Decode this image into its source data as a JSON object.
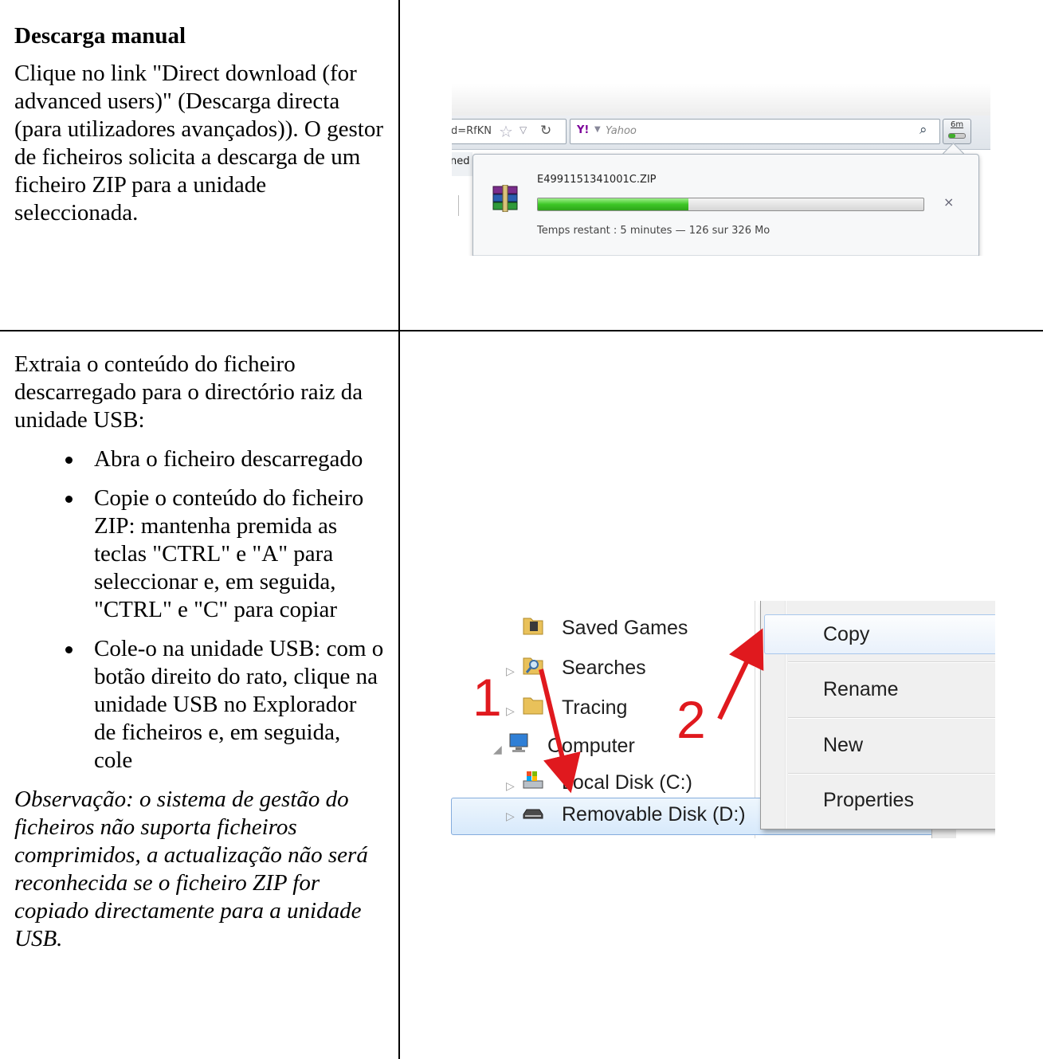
{
  "section1": {
    "title": "Descarga manual",
    "body": "Clique no link \"Direct download (for advanced users)\" (Descarga directa (para utilizadores avançados)). O gestor de ficheiros solicita a descarga de um ficheiro ZIP para a unidade seleccionada."
  },
  "section2": {
    "intro": "Extraia o conteúdo do ficheiro descarregado para o directório raiz da unidade USB:",
    "bullets": [
      "Abra o ficheiro descarregado",
      "Copie o conteúdo do ficheiro ZIP: mantenha premida as teclas \"CTRL\" e \"A\" para seleccionar e, em seguida, \"CTRL\" e \"C\" para copiar",
      "Cole-o na unidade USB: com o botão direito do rato, clique na unidade USB no Explorador de ficheiros e, em seguida, cole"
    ],
    "note": "Observação: o sistema de gestão do ficheiros não suporta ficheiros comprimidos, a actualização não será reconhecida se o ficheiro ZIP for copiado directamente para a unidade USB."
  },
  "browser_shot": {
    "url_fragment": "d=RfKN",
    "search_engine": "Yahoo",
    "yahoo_logo": "Y!",
    "download_button_label": "6m",
    "tab_fragment": "ned",
    "file_name": "E4991151341001C.ZIP",
    "progress_fraction": 0.39,
    "status": "Temps restant : 5 minutes — 126 sur 326 Mo",
    "cancel_symbol": "×"
  },
  "explorer_shot": {
    "tree": [
      "Saved Games",
      "Searches",
      "Tracing",
      "Computer",
      "Local Disk (C:)",
      "Removable Disk (D:)"
    ],
    "context_menu": [
      "Copy",
      "Rename",
      "New",
      "Properties"
    ],
    "step_labels": [
      "1",
      "2"
    ]
  },
  "colors": {
    "progress_green": "#3dc726",
    "arrow_red": "#e0191e",
    "selection_border": "#84acdd"
  }
}
